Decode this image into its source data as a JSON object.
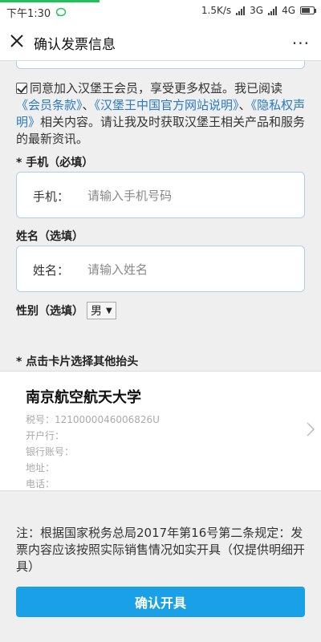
{
  "status_bar": {
    "time": "下午1:30",
    "speed": "1.5K/s",
    "network": "3G",
    "network2": "4G"
  },
  "header": {
    "title": "确认发票信息",
    "more": "···"
  },
  "agreement": {
    "text1": "同意加入汉堡王会员，享受更多权益。我已阅读",
    "link1": "《会员条款》",
    "sep1": "、",
    "link2": "《汉堡王中国官方网站说明》",
    "sep2": "、",
    "link3": "《隐私权声明》",
    "text2": "相关内容。请让我及时获取汉堡王相关产品和服务的最新资讯。"
  },
  "phone": {
    "section_label": "* 手机（必填）",
    "field_label": "手机：",
    "placeholder": "请输入手机号码",
    "value": ""
  },
  "name": {
    "section_label": "姓名（选填）",
    "field_label": "姓名：",
    "placeholder": "请输入姓名",
    "value": ""
  },
  "gender": {
    "label": "性别（选填）",
    "selected": "男",
    "arrow": "▼"
  },
  "invoice_header": {
    "section_label": "* 点击卡片选择其他抬头",
    "company_name": "南京航空航天大学",
    "tax_no": "税号：1210000046006826U",
    "bank": "开户行：",
    "account": "银行账号：",
    "address": "地址：",
    "phone": "电话："
  },
  "note": "注：根据国家税务总局2017年第16号第二条规定：发票内容应该按照实际销售情况如实开具（仅提供明细开具）",
  "confirm_label": "确认开具",
  "colors": {
    "accent": "#1aa0e6",
    "link": "#2a7ac2",
    "progress": "#21c25a"
  }
}
